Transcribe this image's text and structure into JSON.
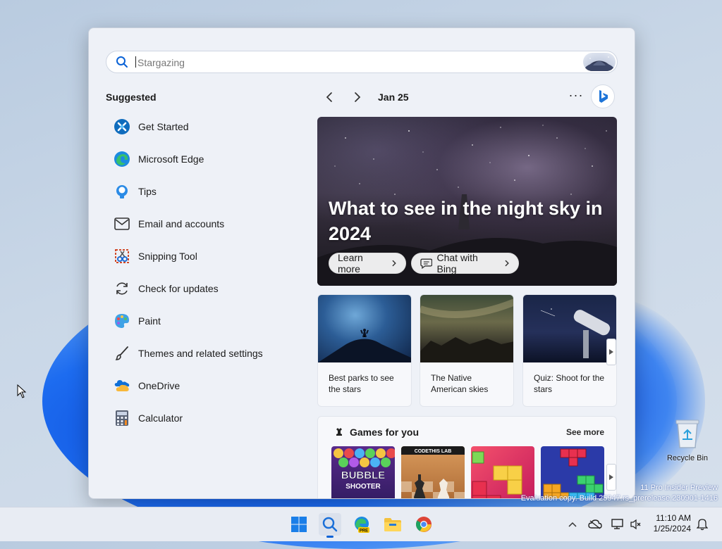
{
  "search": {
    "placeholder": "Stargazing",
    "value": ""
  },
  "suggested": {
    "title": "Suggested",
    "items": [
      {
        "label": "Get Started",
        "icon": "get-started-icon"
      },
      {
        "label": "Microsoft Edge",
        "icon": "edge-icon"
      },
      {
        "label": "Tips",
        "icon": "tips-icon"
      },
      {
        "label": "Email and accounts",
        "icon": "mail-icon"
      },
      {
        "label": "Snipping Tool",
        "icon": "snipping-tool-icon"
      },
      {
        "label": "Check for updates",
        "icon": "refresh-icon"
      },
      {
        "label": "Paint",
        "icon": "paint-icon"
      },
      {
        "label": "Themes and related settings",
        "icon": "brush-icon"
      },
      {
        "label": "OneDrive",
        "icon": "onedrive-icon"
      },
      {
        "label": "Calculator",
        "icon": "calculator-icon"
      }
    ]
  },
  "feed": {
    "date": "Jan 25",
    "hero": {
      "title": "What to see in the night sky in 2024",
      "learn_more": "Learn more",
      "chat_with_bing": "Chat with Bing"
    },
    "cards": [
      {
        "text": "Best parks to see the stars"
      },
      {
        "text": "The Native American skies"
      },
      {
        "text": "Quiz: Shoot for the stars"
      }
    ],
    "games": {
      "title": "Games for you",
      "see_more": "See more",
      "tiles": [
        {
          "name": "BUBBLE SHOOTER HD",
          "line1": "BUBBLE",
          "line2": "SHOOTER"
        },
        {
          "name": "CODETHIS LAB chess",
          "line1": "CODETHIS LAB"
        },
        {
          "name": "Block puzzle"
        },
        {
          "name": "Tetris blocks"
        }
      ]
    }
  },
  "desktop": {
    "recycle_bin": "Recycle Bin",
    "watermark_line1": "11 Pro Insider Preview",
    "watermark_line2": "Evaluation copy. Build 25947.rs_prerelease.230901-1416"
  },
  "taskbar": {
    "time": "11:10 AM",
    "date": "1/25/2024",
    "edge_badge": "PRE"
  },
  "colors": {
    "accent": "#0a62d6",
    "panel_bg": "#eef1f7",
    "taskbar_bg": "#e8ecf3"
  }
}
